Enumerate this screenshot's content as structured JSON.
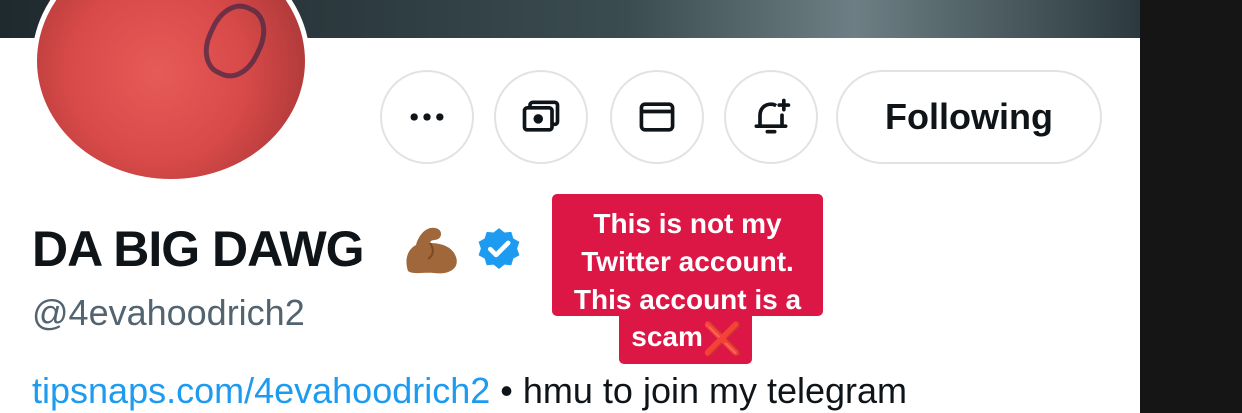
{
  "profile": {
    "display_name": "DA BIG DAWG",
    "emoji_name": "flexed-biceps",
    "handle": "@4evahoodrich2",
    "bio_link": "tipsnaps.com/4evahoodrich2",
    "bio_separator": " • ",
    "bio_text": "hmu to join my telegram"
  },
  "actions": {
    "more_icon": "more-horizontal-icon",
    "subscribe_icon": "money-icon",
    "message_icon": "mail-icon",
    "notify_icon": "bell-plus-icon",
    "following_label": "Following"
  },
  "callout": {
    "line1": "This is not my",
    "line2": "Twitter account.",
    "line3": "This account is a",
    "line4": "scam",
    "mark": "❌"
  },
  "colors": {
    "accent": "#1d9bf0",
    "callout_bg": "#dc1746",
    "text": "#0f1419",
    "muted": "#536471"
  }
}
